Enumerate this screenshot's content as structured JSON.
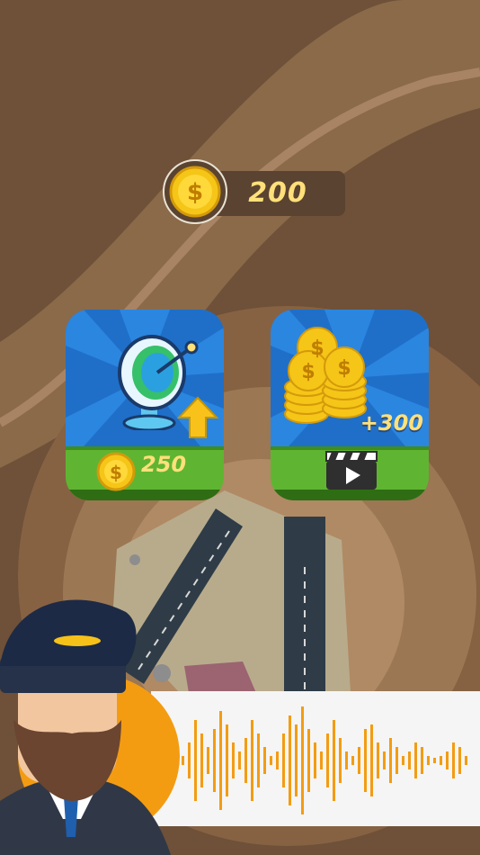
{
  "currency": {
    "coins": "200"
  },
  "upgrade_card": {
    "price": "250",
    "icon": "radar-dish-icon",
    "upgrade_icon": "up-arrow-icon"
  },
  "reward_card": {
    "reward": "+300",
    "icon": "coin-stack-icon",
    "action_icon": "video-play-icon"
  },
  "colors": {
    "brown_bg": "#6e5138",
    "card_blue": "#1f6fc8",
    "grass": "#5fb531",
    "gold": "#ffe07a",
    "orange": "#f39c12"
  },
  "character": {
    "icon": "pilot-avatar"
  },
  "radio": {
    "icon": "voice-waveform"
  }
}
